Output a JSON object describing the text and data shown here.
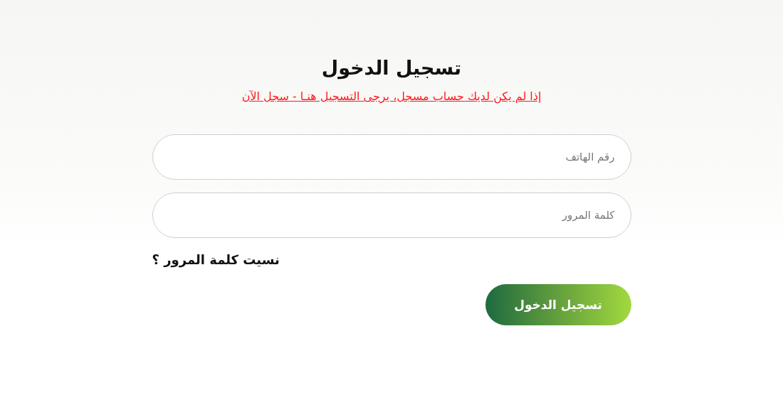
{
  "title": "تسجيل الدخول",
  "register_link": "إذا لم يكن لديك حساب مسجل، يرجى التسجيل هنـا - سجل الآن",
  "fields": [
    {
      "placeholder": "رقم الهاتف"
    },
    {
      "placeholder": "كلمة المرور"
    }
  ],
  "forgot_password": "نسيت كلمة المرور ؟",
  "submit_button": "تسجيل الدخول"
}
